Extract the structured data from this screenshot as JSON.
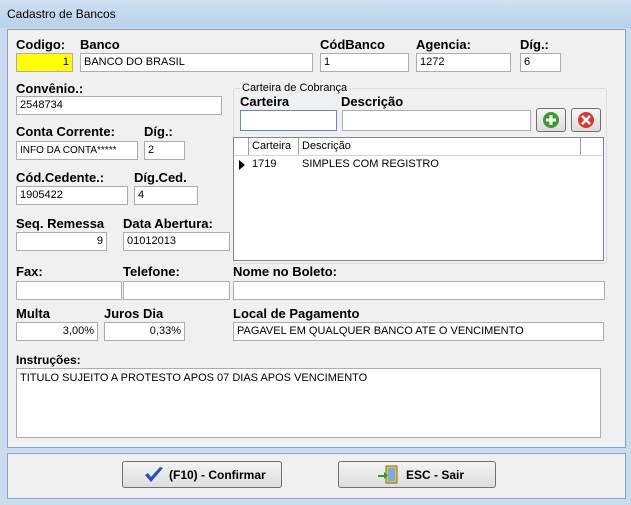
{
  "window": {
    "title": "Cadastro de Bancos"
  },
  "fields": {
    "codigo": {
      "label": "Codigo:",
      "value": "1"
    },
    "banco": {
      "label": "Banco",
      "value": "BANCO DO BRASIL"
    },
    "codbanco": {
      "label": "CódBanco",
      "value": "1"
    },
    "agencia": {
      "label": "Agencia:",
      "value": "1272"
    },
    "dig_agencia": {
      "label": "Díg.:",
      "value": "6"
    },
    "convenio": {
      "label": "Convênio.:",
      "value": "2548734"
    },
    "conta_corrente": {
      "label": "Conta Corrente:",
      "value": "INFO DA CONTA*****"
    },
    "dig_conta": {
      "label": "Díg.:",
      "value": "2"
    },
    "cod_cedente": {
      "label": "Cód.Cedente.:",
      "value": "1905422"
    },
    "dig_ced": {
      "label": "Díg.Ced.",
      "value": "4"
    },
    "seq_remessa": {
      "label": "Seq. Remessa",
      "value": "9"
    },
    "data_abertura": {
      "label": "Data Abertura:",
      "value": "01012013"
    },
    "fax": {
      "label": "Fax:",
      "value": ""
    },
    "telefone": {
      "label": "Telefone:",
      "value": ""
    },
    "nome_boleto": {
      "label": "Nome no Boleto:",
      "value": ""
    },
    "multa": {
      "label": "Multa",
      "value": "3,00%"
    },
    "juros_dia": {
      "label": "Juros Dia",
      "value": "0,33%"
    },
    "local_pagamento": {
      "label": "Local de Pagamento",
      "value": "PAGAVEL EM QUALQUER BANCO ATE O VENCIMENTO"
    },
    "instrucoes": {
      "label": "Instruções:",
      "value": "TITULO SUJEITO A PROTESTO APOS 07 DIAS APOS VENCIMENTO"
    }
  },
  "carteira": {
    "group_title": "Carteira de Cobrança",
    "carteira_label": "Carteira",
    "descricao_label": "Descrição",
    "carteira_value": "",
    "descricao_value": "",
    "grid": {
      "columns": [
        "Carteira",
        "Descrição"
      ],
      "rows": [
        {
          "carteira": "1719",
          "descricao": "SIMPLES COM REGISTRO"
        }
      ]
    }
  },
  "buttons": {
    "confirmar": "(F10) - Confirmar",
    "sair": "ESC - Sair"
  },
  "colors": {
    "codigo_highlight": "#ffff00",
    "add_icon": "#3c9a2e",
    "delete_icon": "#d33a2a",
    "confirm_icon": "#2b4fb5"
  },
  "icons": {
    "add": "plus-icon",
    "delete": "delete-x-icon",
    "confirm": "checkmark-icon",
    "exit": "exit-door-icon"
  }
}
